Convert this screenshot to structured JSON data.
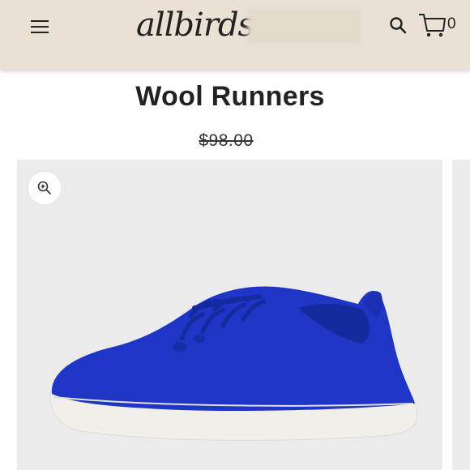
{
  "header": {
    "logo_text": "allbirds",
    "menu_icon": "hamburger-menu-icon",
    "search_icon": "search-icon",
    "cart_icon": "cart-icon",
    "cart_count": "0",
    "background": "#e9e2d4"
  },
  "product": {
    "title": "Wool Runners",
    "price": "$98.00",
    "image_alt": "blue wool running shoe",
    "shoe_color": "#1f35c6",
    "sole_color": "#f0efe9",
    "zoom_icon": "zoom-in-icon"
  }
}
